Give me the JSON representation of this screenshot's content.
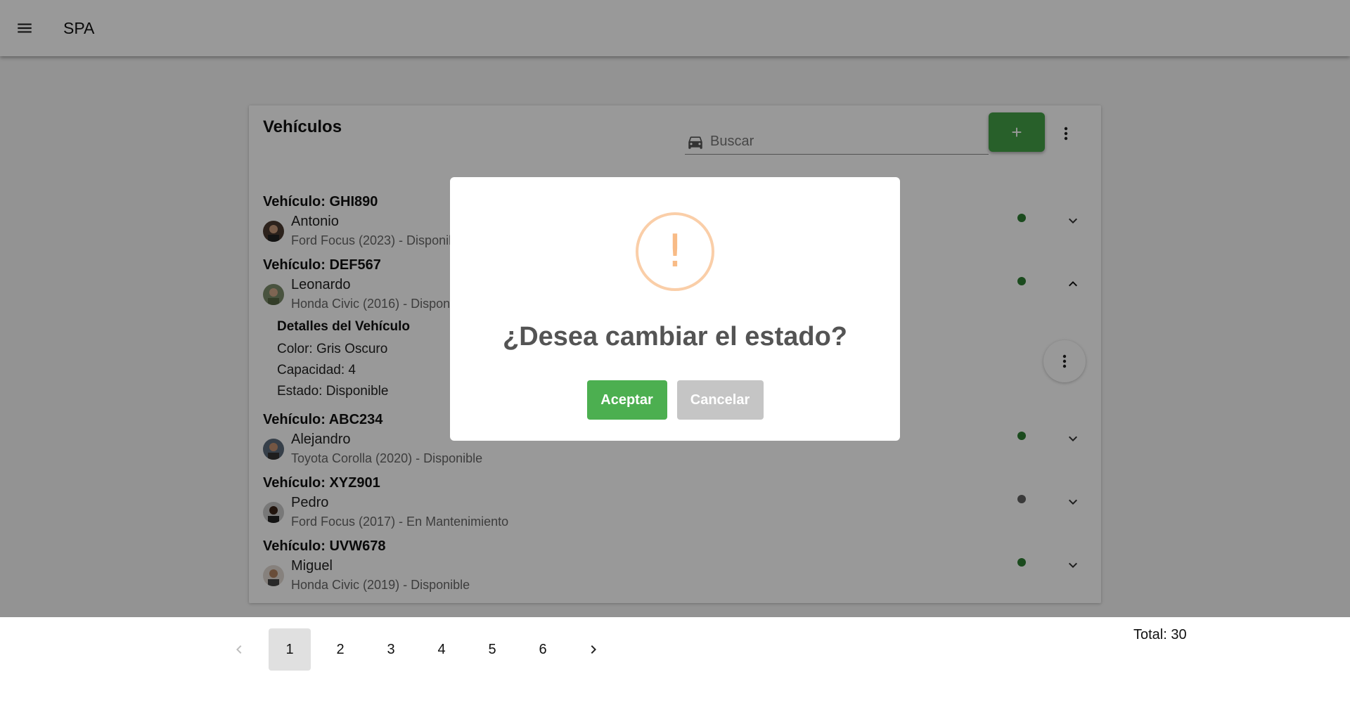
{
  "app": {
    "title": "SPA",
    "menu_icon": "hamburger-menu-icon"
  },
  "card": {
    "title": "Vehículos",
    "search": {
      "placeholder": "Buscar",
      "icon": "car-icon"
    },
    "add_label": "+"
  },
  "vehicles": [
    {
      "title": "Vehículo: GHI890",
      "driver": "Antonio",
      "subtitle": "Ford Focus (2023) - Disponible",
      "status_color": "#2e7d32",
      "expanded": false
    },
    {
      "title": "Vehículo: DEF567",
      "driver": "Leonardo",
      "subtitle": "Honda Civic (2016) - Disponible",
      "status_color": "#2e7d32",
      "expanded": true
    },
    {
      "title": "Vehículo: ABC234",
      "driver": "Alejandro",
      "subtitle": "Toyota Corolla (2020) - Disponible",
      "status_color": "#2e7d32",
      "expanded": false
    },
    {
      "title": "Vehículo: XYZ901",
      "driver": "Pedro",
      "subtitle": "Ford Focus (2017) - En Mantenimiento",
      "status_color": "#616161",
      "expanded": false
    },
    {
      "title": "Vehículo: UVW678",
      "driver": "Miguel",
      "subtitle": "Honda Civic (2019) - Disponible",
      "status_color": "#2e7d32",
      "expanded": false
    }
  ],
  "details": {
    "title": "Detalles del Vehículo",
    "color": "Color: Gris Oscuro",
    "capacity": "Capacidad: 4",
    "state": "Estado: Disponible"
  },
  "pagination": {
    "pages": [
      "1",
      "2",
      "3",
      "4",
      "5",
      "6"
    ],
    "current": "1",
    "total": "Total: 30"
  },
  "dialog": {
    "icon_glyph": "!",
    "title": "¿Desea cambiar el estado?",
    "confirm": "Aceptar",
    "cancel": "Cancelar"
  },
  "colors": {
    "accent_green": "#43a047",
    "warning": "#f8bb86",
    "cancel_gray": "#c5c5c5"
  }
}
